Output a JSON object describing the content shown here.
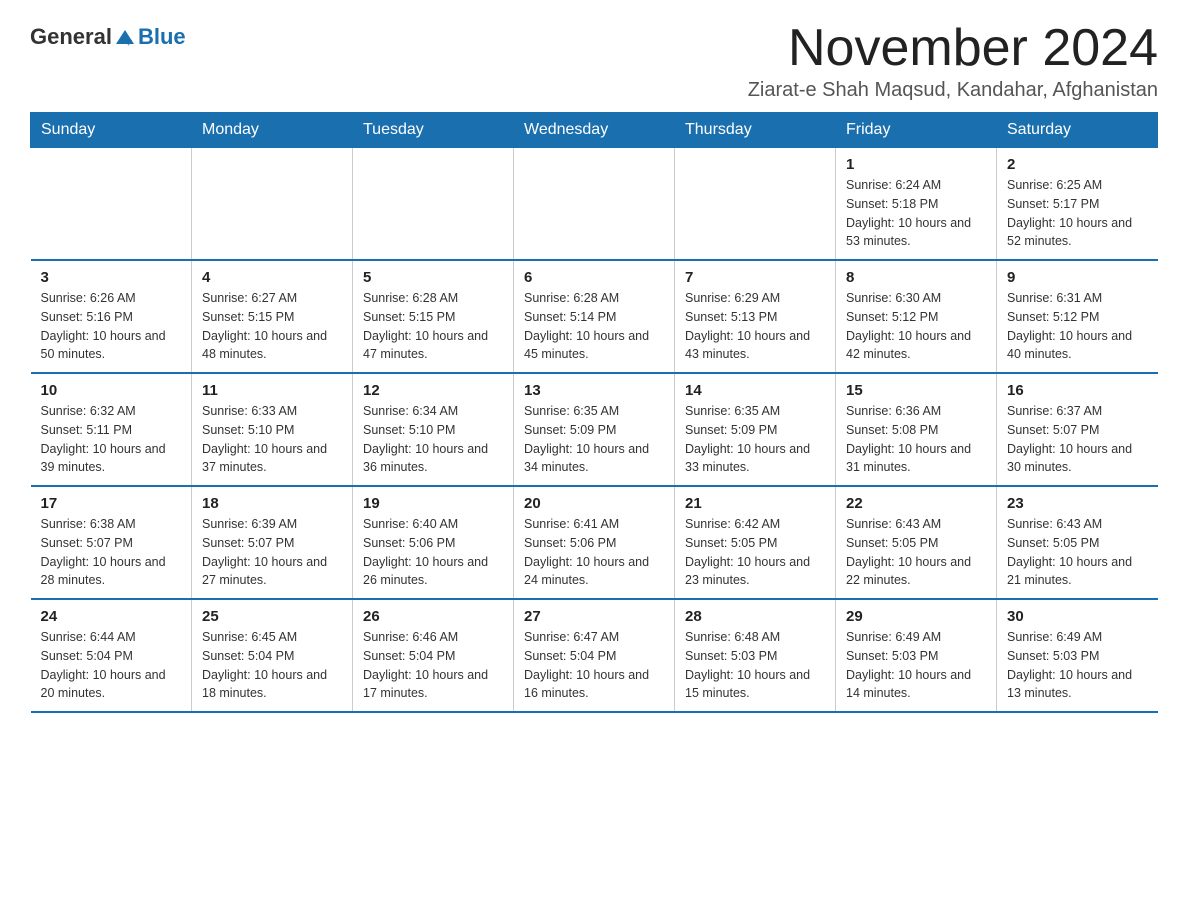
{
  "header": {
    "logo_general": "General",
    "logo_blue": "Blue",
    "month_title": "November 2024",
    "location": "Ziarat-e Shah Maqsud, Kandahar, Afghanistan"
  },
  "weekdays": [
    "Sunday",
    "Monday",
    "Tuesday",
    "Wednesday",
    "Thursday",
    "Friday",
    "Saturday"
  ],
  "weeks": [
    [
      {
        "day": "",
        "info": ""
      },
      {
        "day": "",
        "info": ""
      },
      {
        "day": "",
        "info": ""
      },
      {
        "day": "",
        "info": ""
      },
      {
        "day": "",
        "info": ""
      },
      {
        "day": "1",
        "info": "Sunrise: 6:24 AM\nSunset: 5:18 PM\nDaylight: 10 hours and 53 minutes."
      },
      {
        "day": "2",
        "info": "Sunrise: 6:25 AM\nSunset: 5:17 PM\nDaylight: 10 hours and 52 minutes."
      }
    ],
    [
      {
        "day": "3",
        "info": "Sunrise: 6:26 AM\nSunset: 5:16 PM\nDaylight: 10 hours and 50 minutes."
      },
      {
        "day": "4",
        "info": "Sunrise: 6:27 AM\nSunset: 5:15 PM\nDaylight: 10 hours and 48 minutes."
      },
      {
        "day": "5",
        "info": "Sunrise: 6:28 AM\nSunset: 5:15 PM\nDaylight: 10 hours and 47 minutes."
      },
      {
        "day": "6",
        "info": "Sunrise: 6:28 AM\nSunset: 5:14 PM\nDaylight: 10 hours and 45 minutes."
      },
      {
        "day": "7",
        "info": "Sunrise: 6:29 AM\nSunset: 5:13 PM\nDaylight: 10 hours and 43 minutes."
      },
      {
        "day": "8",
        "info": "Sunrise: 6:30 AM\nSunset: 5:12 PM\nDaylight: 10 hours and 42 minutes."
      },
      {
        "day": "9",
        "info": "Sunrise: 6:31 AM\nSunset: 5:12 PM\nDaylight: 10 hours and 40 minutes."
      }
    ],
    [
      {
        "day": "10",
        "info": "Sunrise: 6:32 AM\nSunset: 5:11 PM\nDaylight: 10 hours and 39 minutes."
      },
      {
        "day": "11",
        "info": "Sunrise: 6:33 AM\nSunset: 5:10 PM\nDaylight: 10 hours and 37 minutes."
      },
      {
        "day": "12",
        "info": "Sunrise: 6:34 AM\nSunset: 5:10 PM\nDaylight: 10 hours and 36 minutes."
      },
      {
        "day": "13",
        "info": "Sunrise: 6:35 AM\nSunset: 5:09 PM\nDaylight: 10 hours and 34 minutes."
      },
      {
        "day": "14",
        "info": "Sunrise: 6:35 AM\nSunset: 5:09 PM\nDaylight: 10 hours and 33 minutes."
      },
      {
        "day": "15",
        "info": "Sunrise: 6:36 AM\nSunset: 5:08 PM\nDaylight: 10 hours and 31 minutes."
      },
      {
        "day": "16",
        "info": "Sunrise: 6:37 AM\nSunset: 5:07 PM\nDaylight: 10 hours and 30 minutes."
      }
    ],
    [
      {
        "day": "17",
        "info": "Sunrise: 6:38 AM\nSunset: 5:07 PM\nDaylight: 10 hours and 28 minutes."
      },
      {
        "day": "18",
        "info": "Sunrise: 6:39 AM\nSunset: 5:07 PM\nDaylight: 10 hours and 27 minutes."
      },
      {
        "day": "19",
        "info": "Sunrise: 6:40 AM\nSunset: 5:06 PM\nDaylight: 10 hours and 26 minutes."
      },
      {
        "day": "20",
        "info": "Sunrise: 6:41 AM\nSunset: 5:06 PM\nDaylight: 10 hours and 24 minutes."
      },
      {
        "day": "21",
        "info": "Sunrise: 6:42 AM\nSunset: 5:05 PM\nDaylight: 10 hours and 23 minutes."
      },
      {
        "day": "22",
        "info": "Sunrise: 6:43 AM\nSunset: 5:05 PM\nDaylight: 10 hours and 22 minutes."
      },
      {
        "day": "23",
        "info": "Sunrise: 6:43 AM\nSunset: 5:05 PM\nDaylight: 10 hours and 21 minutes."
      }
    ],
    [
      {
        "day": "24",
        "info": "Sunrise: 6:44 AM\nSunset: 5:04 PM\nDaylight: 10 hours and 20 minutes."
      },
      {
        "day": "25",
        "info": "Sunrise: 6:45 AM\nSunset: 5:04 PM\nDaylight: 10 hours and 18 minutes."
      },
      {
        "day": "26",
        "info": "Sunrise: 6:46 AM\nSunset: 5:04 PM\nDaylight: 10 hours and 17 minutes."
      },
      {
        "day": "27",
        "info": "Sunrise: 6:47 AM\nSunset: 5:04 PM\nDaylight: 10 hours and 16 minutes."
      },
      {
        "day": "28",
        "info": "Sunrise: 6:48 AM\nSunset: 5:03 PM\nDaylight: 10 hours and 15 minutes."
      },
      {
        "day": "29",
        "info": "Sunrise: 6:49 AM\nSunset: 5:03 PM\nDaylight: 10 hours and 14 minutes."
      },
      {
        "day": "30",
        "info": "Sunrise: 6:49 AM\nSunset: 5:03 PM\nDaylight: 10 hours and 13 minutes."
      }
    ]
  ]
}
